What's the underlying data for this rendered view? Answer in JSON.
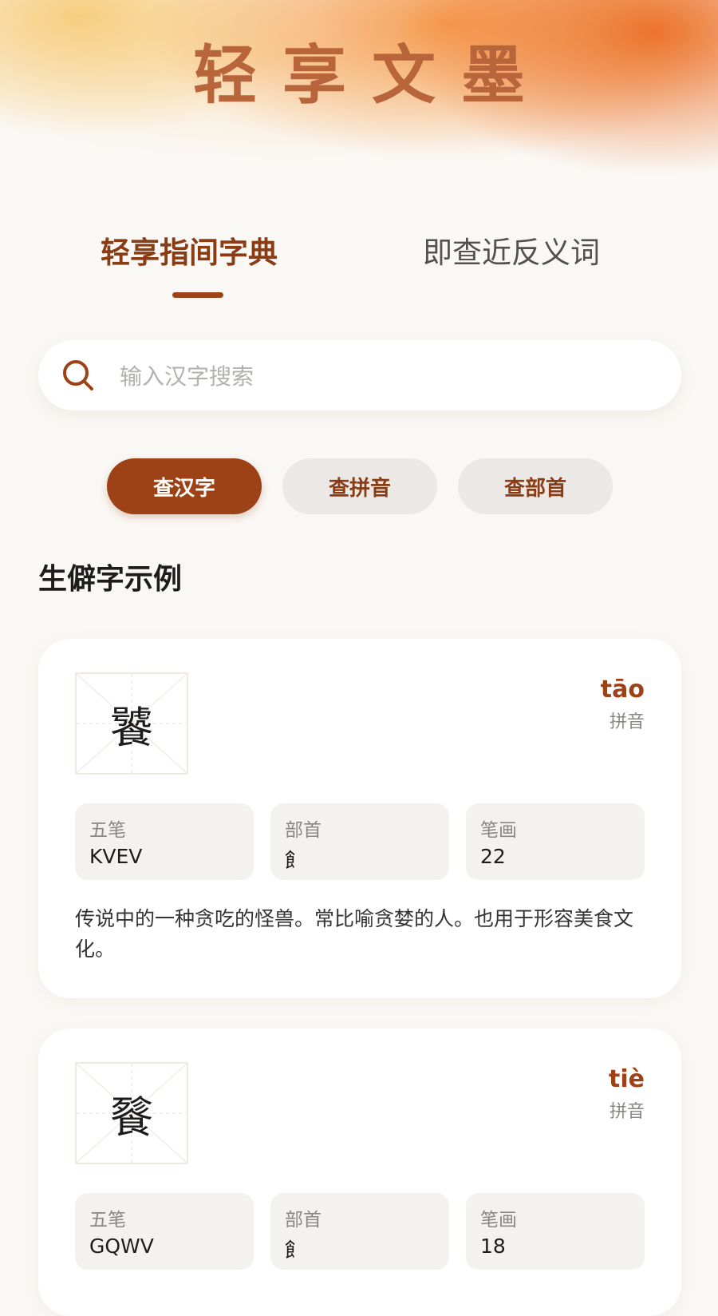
{
  "app": {
    "title": "轻享文墨"
  },
  "tabs": [
    {
      "label": "轻享指间字典",
      "active": true
    },
    {
      "label": "即查近反义词",
      "active": false
    }
  ],
  "search": {
    "placeholder": "输入汉字搜索",
    "value": ""
  },
  "filters": [
    {
      "label": "查汉字",
      "active": true
    },
    {
      "label": "查拼音",
      "active": false
    },
    {
      "label": "查部首",
      "active": false
    }
  ],
  "section": {
    "title": "生僻字示例"
  },
  "cards": [
    {
      "character": "饕",
      "pinyin": "tāo",
      "pinyin_label": "拼音",
      "wubi_label": "五笔",
      "wubi": "KVEV",
      "radical_label": "部首",
      "radical": "飠",
      "strokes_label": "笔画",
      "strokes": "22",
      "description": "传说中的一种贪吃的怪兽。常比喻贪婪的人。也用于形容美食文化。"
    },
    {
      "character": "餮",
      "pinyin": "tiè",
      "pinyin_label": "拼音",
      "wubi_label": "五笔",
      "wubi": "GQWV",
      "radical_label": "部首",
      "radical": "飠",
      "strokes_label": "笔画",
      "strokes": "18"
    }
  ],
  "colors": {
    "accent": "#9c4216",
    "title": "#b8653b",
    "pill_inactive": "#ebe8e5",
    "background": "#faf8f5"
  },
  "icons": {
    "search": "search-icon"
  }
}
